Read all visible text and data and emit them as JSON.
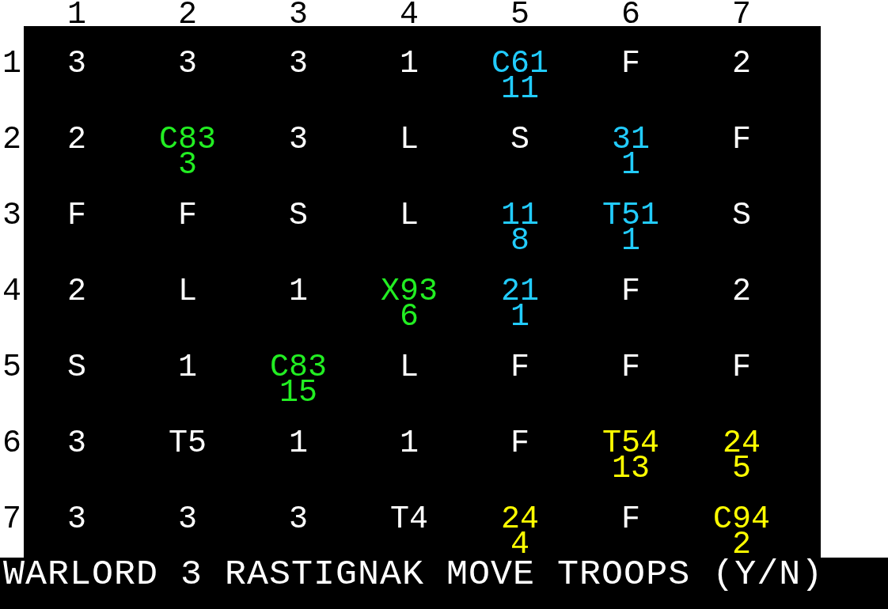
{
  "column_headers": [
    "1",
    "2",
    "3",
    "4",
    "5",
    "6",
    "7"
  ],
  "rows": [
    {
      "label": "1",
      "cells": [
        {
          "lines": [
            "3"
          ],
          "color": "#ffffff"
        },
        {
          "lines": [
            "3"
          ],
          "color": "#ffffff"
        },
        {
          "lines": [
            "3"
          ],
          "color": "#ffffff"
        },
        {
          "lines": [
            "1"
          ],
          "color": "#ffffff"
        },
        {
          "lines": [
            "C61",
            "11"
          ],
          "color": "#22ccff"
        },
        {
          "lines": [
            "F"
          ],
          "color": "#ffffff"
        },
        {
          "lines": [
            "2"
          ],
          "color": "#ffffff"
        }
      ]
    },
    {
      "label": "2",
      "cells": [
        {
          "lines": [
            "2"
          ],
          "color": "#ffffff"
        },
        {
          "lines": [
            "C83",
            "3"
          ],
          "color": "#22ee22"
        },
        {
          "lines": [
            "3"
          ],
          "color": "#ffffff"
        },
        {
          "lines": [
            "L"
          ],
          "color": "#ffffff"
        },
        {
          "lines": [
            "S"
          ],
          "color": "#ffffff"
        },
        {
          "lines": [
            "31",
            "1"
          ],
          "color": "#22ccff"
        },
        {
          "lines": [
            "F"
          ],
          "color": "#ffffff"
        }
      ]
    },
    {
      "label": "3",
      "cells": [
        {
          "lines": [
            "F"
          ],
          "color": "#ffffff"
        },
        {
          "lines": [
            "F"
          ],
          "color": "#ffffff"
        },
        {
          "lines": [
            "S"
          ],
          "color": "#ffffff"
        },
        {
          "lines": [
            "L"
          ],
          "color": "#ffffff"
        },
        {
          "lines": [
            "11",
            "8"
          ],
          "color": "#22ccff"
        },
        {
          "lines": [
            "T51",
            "1"
          ],
          "color": "#22ccff"
        },
        {
          "lines": [
            "S"
          ],
          "color": "#ffffff"
        }
      ]
    },
    {
      "label": "4",
      "cells": [
        {
          "lines": [
            "2"
          ],
          "color": "#ffffff"
        },
        {
          "lines": [
            "L"
          ],
          "color": "#ffffff"
        },
        {
          "lines": [
            "1"
          ],
          "color": "#ffffff"
        },
        {
          "lines": [
            "X93",
            "6"
          ],
          "color": "#22ee22"
        },
        {
          "lines": [
            "21",
            "1"
          ],
          "color": "#22ccff"
        },
        {
          "lines": [
            "F"
          ],
          "color": "#ffffff"
        },
        {
          "lines": [
            "2"
          ],
          "color": "#ffffff"
        }
      ]
    },
    {
      "label": "5",
      "cells": [
        {
          "lines": [
            "S"
          ],
          "color": "#ffffff"
        },
        {
          "lines": [
            "1"
          ],
          "color": "#ffffff"
        },
        {
          "lines": [
            "C83",
            "15"
          ],
          "color": "#22ee22"
        },
        {
          "lines": [
            "L"
          ],
          "color": "#ffffff"
        },
        {
          "lines": [
            "F"
          ],
          "color": "#ffffff"
        },
        {
          "lines": [
            "F"
          ],
          "color": "#ffffff"
        },
        {
          "lines": [
            "F"
          ],
          "color": "#ffffff"
        }
      ]
    },
    {
      "label": "6",
      "cells": [
        {
          "lines": [
            "3"
          ],
          "color": "#ffffff"
        },
        {
          "lines": [
            "T5"
          ],
          "color": "#ffffff"
        },
        {
          "lines": [
            "1"
          ],
          "color": "#ffffff"
        },
        {
          "lines": [
            "1"
          ],
          "color": "#ffffff"
        },
        {
          "lines": [
            "F"
          ],
          "color": "#ffffff"
        },
        {
          "lines": [
            "T54",
            "13"
          ],
          "color": "#ffff00"
        },
        {
          "lines": [
            "24",
            "5"
          ],
          "color": "#ffff00"
        }
      ]
    },
    {
      "label": "7",
      "cells": [
        {
          "lines": [
            "3"
          ],
          "color": "#ffffff"
        },
        {
          "lines": [
            "3"
          ],
          "color": "#ffffff"
        },
        {
          "lines": [
            "3"
          ],
          "color": "#ffffff"
        },
        {
          "lines": [
            "T4"
          ],
          "color": "#ffffff"
        },
        {
          "lines": [
            "24",
            "4"
          ],
          "color": "#ffff00"
        },
        {
          "lines": [
            "F"
          ],
          "color": "#ffffff"
        },
        {
          "lines": [
            "C94",
            "2"
          ],
          "color": "#ffff00"
        }
      ]
    }
  ],
  "prompt": "WARLORD 3 RASTIGNAK MOVE TROOPS (Y/N)"
}
